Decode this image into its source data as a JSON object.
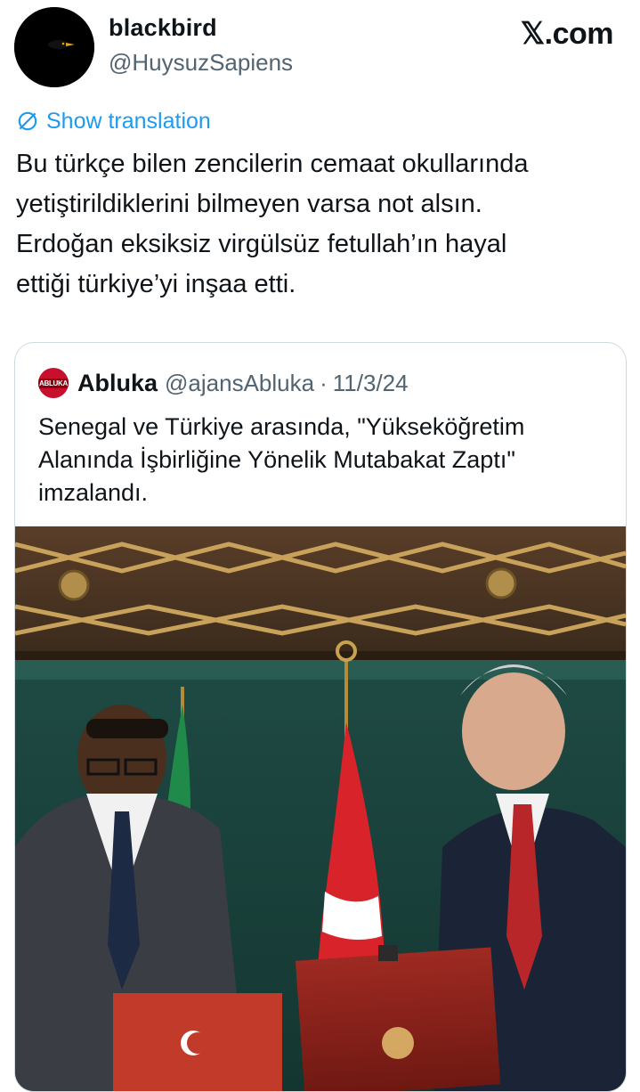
{
  "author": {
    "display_name": "blackbird",
    "handle": "@HuysuzSapiens"
  },
  "brand": "𝕏.com",
  "translate_label": "Show translation",
  "tweet_lines": [
    "Bu türkçe bilen zencilerin cemaat okullarında",
    "yetiştirildiklerini bilmeyen varsa not alsın.",
    "Erdoğan eksiksiz virgülsüz fetullah’ın hayal",
    "ettiği türkiye’yi inşaa etti."
  ],
  "quote": {
    "logo_text": "ABLUKA",
    "name": "Abluka",
    "handle": "@ajansAbluka",
    "separator": "·",
    "date": "11/3/24",
    "text_lines": [
      "Senegal ve Türkiye arasında, \"Yükseköğretim",
      "Alanında İşbirliğine Yönelik Mutabakat Zaptı\"",
      "imzalandı."
    ]
  },
  "colors": {
    "link": "#1d9bf0",
    "secondary_text": "#536471",
    "border": "#cfd9de",
    "abluka_red": "#c8102e"
  },
  "icons": {
    "translate": "globe-slash-icon"
  }
}
